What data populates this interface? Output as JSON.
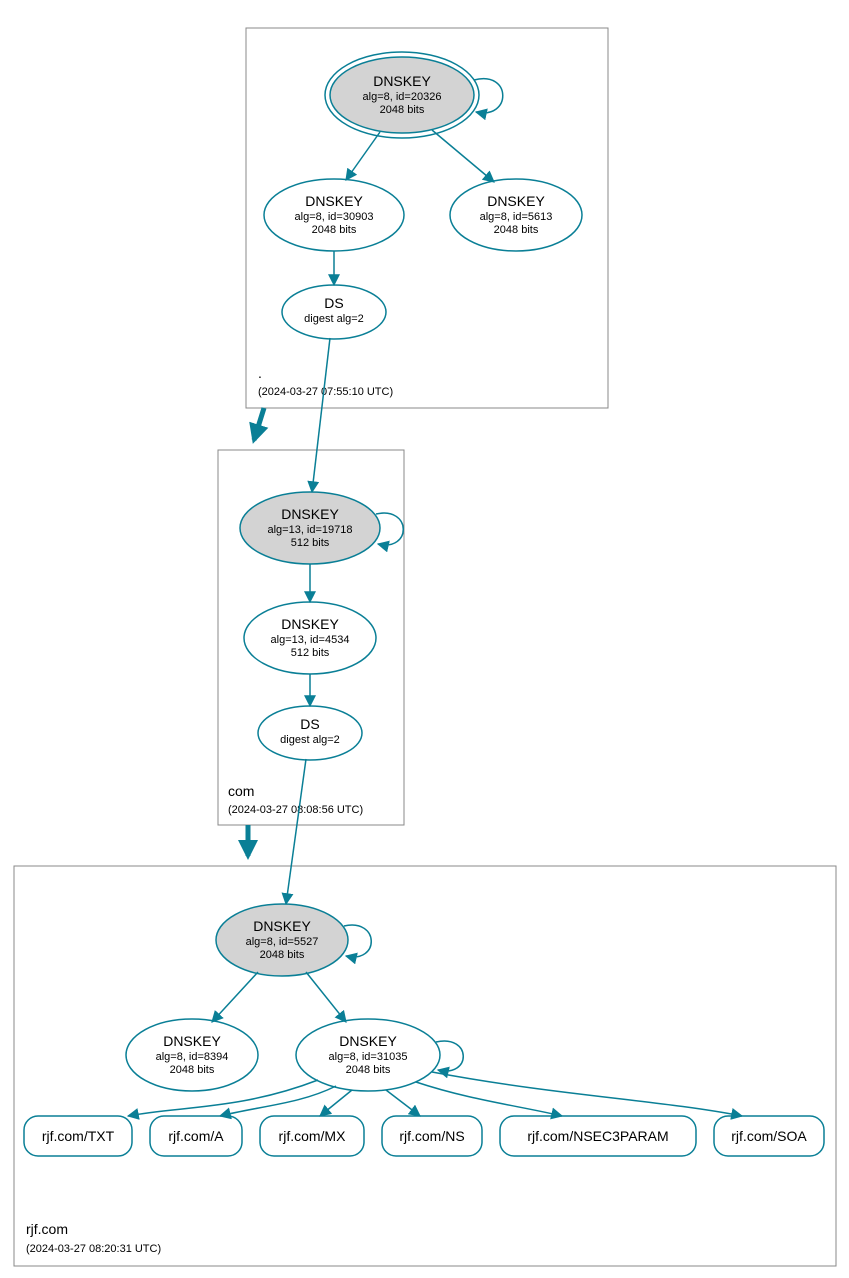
{
  "colors": {
    "accent": "#0a7f96",
    "nodeFill": "#d3d3d3"
  },
  "zones": {
    "root": {
      "label": ".",
      "time": "(2024-03-27 07:55:10 UTC)"
    },
    "com": {
      "label": "com",
      "time": "(2024-03-27 08:08:56 UTC)"
    },
    "rjf": {
      "label": "rjf.com",
      "time": "(2024-03-27 08:20:31 UTC)"
    }
  },
  "nodes": {
    "root_ksk": {
      "title": "DNSKEY",
      "l2": "alg=8, id=20326",
      "l3": "2048 bits"
    },
    "root_zsk1": {
      "title": "DNSKEY",
      "l2": "alg=8, id=30903",
      "l3": "2048 bits"
    },
    "root_zsk2": {
      "title": "DNSKEY",
      "l2": "alg=8, id=5613",
      "l3": "2048 bits"
    },
    "root_ds": {
      "title": "DS",
      "l2": "digest alg=2"
    },
    "com_ksk": {
      "title": "DNSKEY",
      "l2": "alg=13, id=19718",
      "l3": "512 bits"
    },
    "com_zsk": {
      "title": "DNSKEY",
      "l2": "alg=13, id=4534",
      "l3": "512 bits"
    },
    "com_ds": {
      "title": "DS",
      "l2": "digest alg=2"
    },
    "rjf_ksk": {
      "title": "DNSKEY",
      "l2": "alg=8, id=5527",
      "l3": "2048 bits"
    },
    "rjf_zsk1": {
      "title": "DNSKEY",
      "l2": "alg=8, id=8394",
      "l3": "2048 bits"
    },
    "rjf_zsk2": {
      "title": "DNSKEY",
      "l2": "alg=8, id=31035",
      "l3": "2048 bits"
    }
  },
  "rr": {
    "txt": "rjf.com/TXT",
    "a": "rjf.com/A",
    "mx": "rjf.com/MX",
    "ns": "rjf.com/NS",
    "nsec3": "rjf.com/NSEC3PARAM",
    "soa": "rjf.com/SOA"
  }
}
